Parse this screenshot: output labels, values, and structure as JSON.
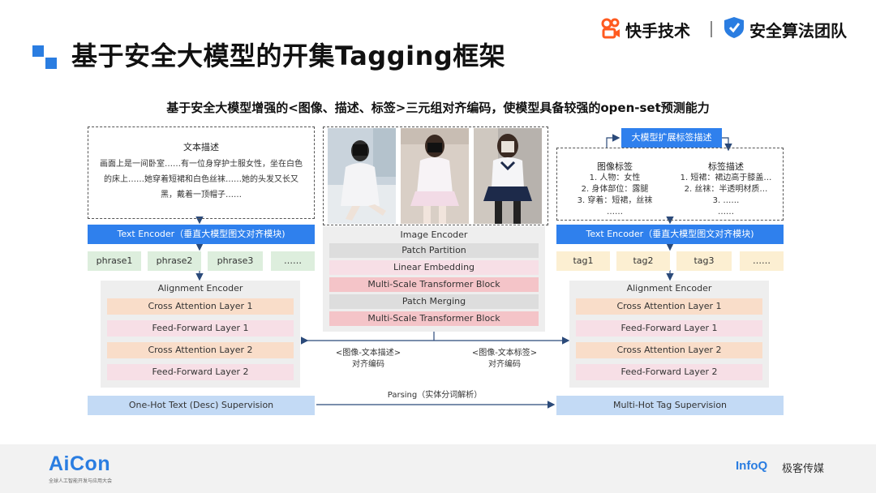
{
  "header": {
    "title": "基于安全大模型的开集Tagging框架",
    "logo_kuaishou": "快手技术",
    "logo_team": "安全算法团队",
    "subtitle": "基于安全大模型增强的<图像、描述、标签>三元组对齐编码，使模型具备较强的open-set预测能力"
  },
  "left": {
    "desc_title": "文本描述",
    "desc_text": "画面上是一间卧室……有一位身穿护士服女性，坐在白色的床上……她穿着短裙和白色丝袜……她的头发又长又黑，戴着一顶帽子……",
    "text_encoder": "Text Encoder（垂直大模型图文对齐模块)",
    "phrases": [
      "phrase1",
      "phrase2",
      "phrase3",
      "……"
    ],
    "align_title": "Alignment Encoder",
    "layers": [
      "Cross Attention Layer 1",
      "Feed-Forward Layer 1",
      "Cross Attention Layer 2",
      "Feed-Forward Layer 2"
    ],
    "supervision": "One-Hot Text (Desc) Supervision"
  },
  "center": {
    "image_encoder_title": "Image Encoder",
    "image_layers": [
      "Patch Partition",
      "Linear Embedding",
      "Multi-Scale Transformer Block",
      "Patch Merging",
      "Multi-Scale Transformer Block"
    ],
    "caption_left_1": "<图像-文本描述>",
    "caption_left_2": "对齐编码",
    "caption_right_1": "<图像-文本标签>",
    "caption_right_2": "对齐编码",
    "parsing": "Parsing（实体分词解析）"
  },
  "right": {
    "expand_button": "大模型扩展标签描述",
    "img_tag_title": "图像标签",
    "img_tags": [
      "1. 人物：女性",
      "2. 身体部位：露腿",
      "3. 穿着：短裙，丝袜",
      "……"
    ],
    "tag_desc_title": "标签描述",
    "tag_descs": [
      "1. 短裙：裙边高于膝盖…",
      "2. 丝袜：半透明材质…",
      "3. ……",
      "……"
    ],
    "text_encoder": "Text Encoder（垂直大模型图文对齐模块)",
    "tags": [
      "tag1",
      "tag2",
      "tag3",
      "……"
    ],
    "align_title": "Alignment Encoder",
    "layers": [
      "Cross Attention Layer 1",
      "Feed-Forward Layer 1",
      "Cross Attention Layer 2",
      "Feed-Forward Layer 2"
    ],
    "supervision": "Multi-Hot Tag Supervision"
  },
  "footer": {
    "aicon": "AiCon",
    "aicon_sub": "全球人工智能开发与应用大会",
    "infoq": "InfoQ",
    "infoq_cn": "极客传媒"
  },
  "colors": {
    "accent": "#2f80ed",
    "supervision": "#c3daf5",
    "phrase_chip": "#ddeedd",
    "tag_chip": "#fcefd2",
    "cross_attention": "#f9ddc9",
    "feed_forward": "#f7dfe6",
    "transformer_block": "#f4c4c8"
  }
}
